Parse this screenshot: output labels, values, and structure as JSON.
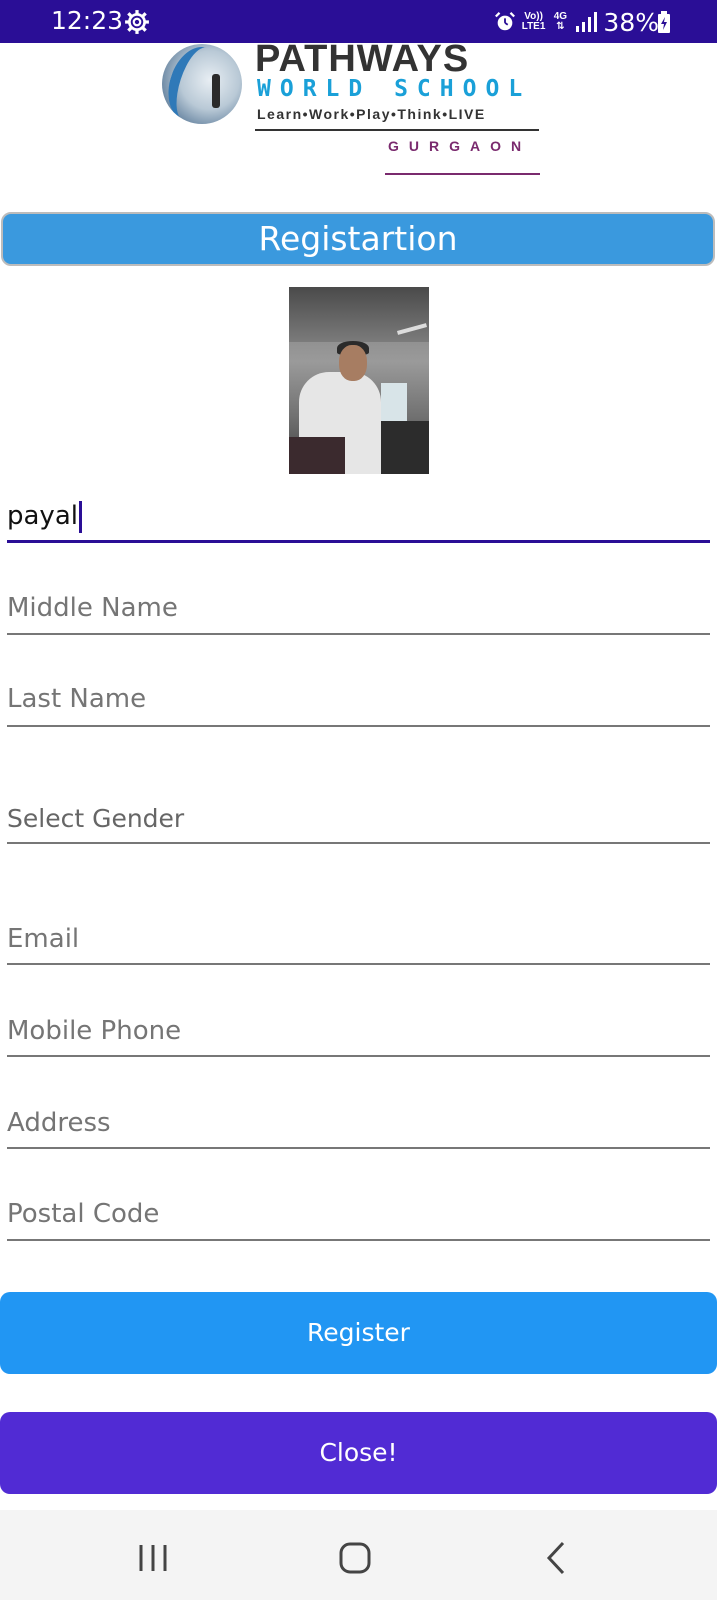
{
  "status_bar": {
    "time": "12:23",
    "network_top": "Vo))",
    "network_bottom": "LTE1",
    "network_type": "4G",
    "battery": "38%",
    "icons": [
      "gear-icon",
      "alarm-icon",
      "signal-icon",
      "battery-charging-icon"
    ]
  },
  "logo": {
    "line1": "PATHWAYS",
    "line2": "WORLD SCHOOL",
    "tagline": "Learn•Work•Play•Think•LIVE",
    "city": "GURGAON"
  },
  "header": {
    "title": "Registartion"
  },
  "form": {
    "first_name_value": "payal",
    "middle_name_placeholder": "Middle Name",
    "last_name_placeholder": "Last Name",
    "gender_label": "Select Gender",
    "email_placeholder": "Email",
    "mobile_placeholder": "Mobile Phone",
    "address_placeholder": "Address",
    "postal_placeholder": "Postal Code"
  },
  "buttons": {
    "register": "Register",
    "close": "Close!"
  },
  "colors": {
    "status_bar": "#2a0e96",
    "header_bg": "#3a99de",
    "register_bg": "#2196f3",
    "close_bg": "#512bd4",
    "active_line": "#2a0e96"
  }
}
